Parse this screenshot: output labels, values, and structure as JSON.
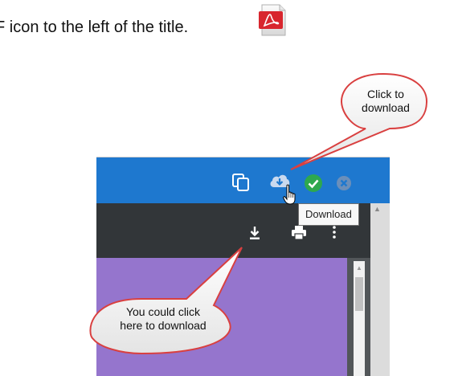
{
  "intro": {
    "text": "F icon to the left of the title."
  },
  "icons": {
    "pdf": "pdf-icon",
    "copy": "copy-icon",
    "cloud_download": "cloud-download-icon",
    "check": "check-circle-icon",
    "cancel": "cancel-circle-icon",
    "cursor": "hand-pointer-icon",
    "download": "download-icon",
    "print": "print-icon",
    "more": "more-vertical-icon"
  },
  "toolbar": {
    "tooltip": "Download"
  },
  "callouts": {
    "top": {
      "line1": "Click to",
      "line2": "download"
    },
    "left": {
      "line1": "You could click",
      "line2": "here to download"
    }
  },
  "colors": {
    "blue_bar": "#1e78cf",
    "dark_bar": "#323639",
    "purple_page": "#9575cd",
    "check_green": "#2ea84e",
    "callout_border": "#d94040"
  }
}
